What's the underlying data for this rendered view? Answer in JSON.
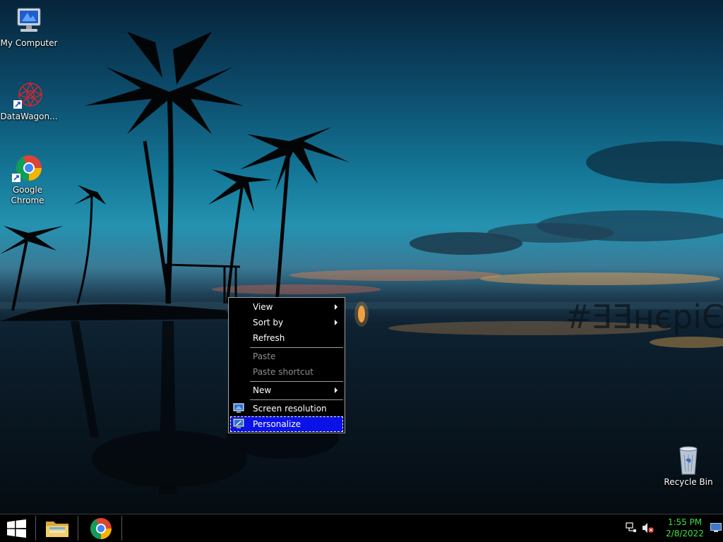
{
  "desktop": {
    "watermark_text": "#ƎƎнєріЄОВІ",
    "icons": [
      {
        "label": "My Computer"
      },
      {
        "label": "DataWagon..."
      },
      {
        "label": "Google Chrome"
      },
      {
        "label": "Recycle Bin"
      }
    ]
  },
  "context_menu": {
    "items": [
      {
        "label": "View",
        "submenu": true,
        "enabled": true
      },
      {
        "label": "Sort by",
        "submenu": true,
        "enabled": true
      },
      {
        "label": "Refresh",
        "submenu": false,
        "enabled": true
      },
      {
        "label": "Paste",
        "submenu": false,
        "enabled": false
      },
      {
        "label": "Paste shortcut",
        "submenu": false,
        "enabled": false
      },
      {
        "label": "New",
        "submenu": true,
        "enabled": true
      },
      {
        "label": "Screen resolution",
        "submenu": false,
        "enabled": true,
        "icon": "monitor-icon"
      },
      {
        "label": "Personalize",
        "submenu": false,
        "enabled": true,
        "icon": "monitor-icon",
        "highlighted": true
      }
    ]
  },
  "taskbar": {
    "start_icon": "windows-logo-icon",
    "pinned": [
      {
        "name": "file-explorer",
        "icon": "folder-icon"
      },
      {
        "name": "google-chrome",
        "icon": "chrome-icon"
      }
    ],
    "tray": {
      "network_icon": "network-icon",
      "volume_icon": "volume-muted-icon"
    },
    "clock": {
      "time": "1:55 PM",
      "date": "2/8/2022"
    },
    "show_desktop_icon": "show-desktop-icon"
  },
  "colors": {
    "menu_highlight": "#0a12e8",
    "clock_text": "#3fe03f",
    "menu_background": "#000000"
  }
}
